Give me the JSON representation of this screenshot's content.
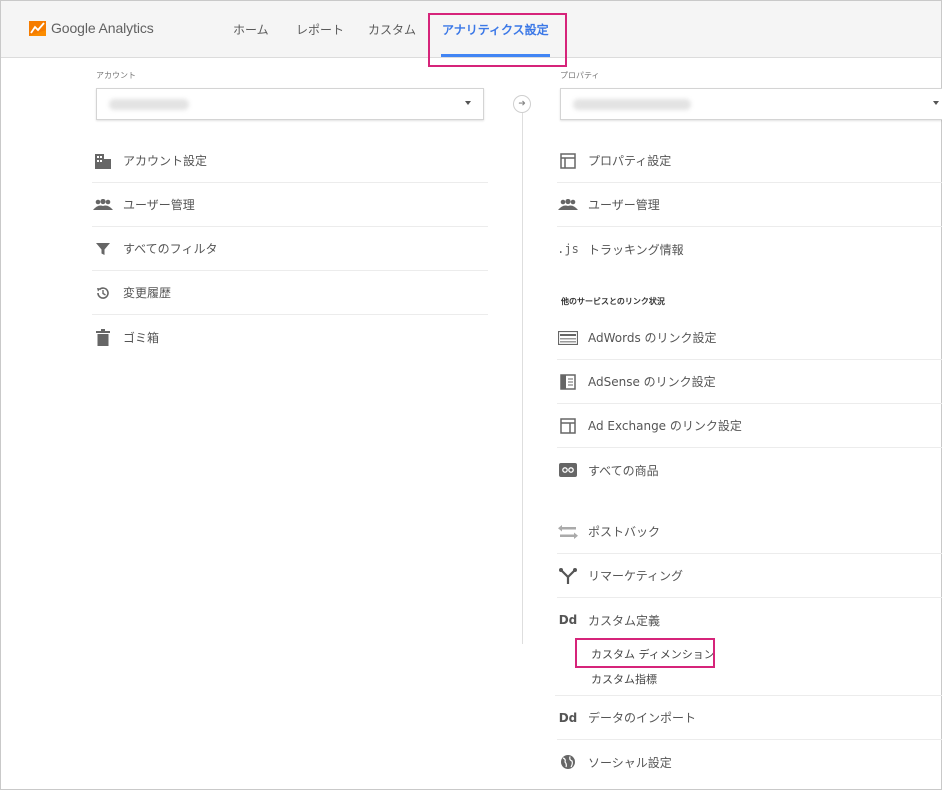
{
  "app": {
    "logo_text": "Google Analytics",
    "accent": "#4285f4",
    "highlight": "#d6247a"
  },
  "nav": {
    "tabs": [
      "ホーム",
      "レポート",
      "カスタム",
      "アナリティクス設定"
    ],
    "active_index": 3
  },
  "account": {
    "label": "アカウント",
    "items": [
      {
        "icon": "building-icon",
        "label": "アカウント設定"
      },
      {
        "icon": "users-icon",
        "label": "ユーザー管理"
      },
      {
        "icon": "filter-icon",
        "label": "すべてのフィルタ"
      },
      {
        "icon": "history-icon",
        "label": "変更履歴"
      },
      {
        "icon": "trash-icon",
        "label": "ゴミ箱"
      }
    ]
  },
  "property": {
    "label": "プロパティ",
    "items": [
      {
        "icon": "property-icon",
        "label": "プロパティ設定"
      },
      {
        "icon": "users-icon",
        "label": "ユーザー管理"
      },
      {
        "icon": "js-icon",
        "label": "トラッキング情報"
      }
    ],
    "link_section_label": "他のサービスとのリンク状況",
    "link_items": [
      {
        "icon": "adwords-icon",
        "label": "AdWords のリンク設定"
      },
      {
        "icon": "adsense-icon",
        "label": "AdSense のリンク設定"
      },
      {
        "icon": "adexchange-icon",
        "label": "Ad Exchange のリンク設定"
      },
      {
        "icon": "products-icon",
        "label": "すべての商品"
      }
    ],
    "more_items": [
      {
        "icon": "postback-icon",
        "label": "ポストバック"
      },
      {
        "icon": "remarketing-icon",
        "label": "リマーケティング"
      },
      {
        "icon": "dd-icon",
        "label": "カスタム定義"
      }
    ],
    "custom_definition_subitems": [
      "カスタム ディメンション",
      "カスタム指標"
    ],
    "last_items": [
      {
        "icon": "dd-icon",
        "label": "データのインポート"
      },
      {
        "icon": "globe-icon",
        "label": "ソーシャル設定"
      }
    ]
  }
}
